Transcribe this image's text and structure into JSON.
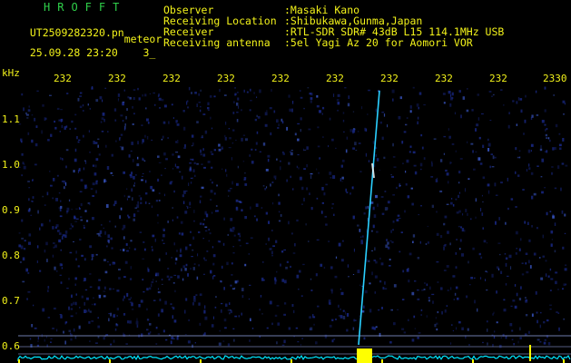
{
  "header": {
    "brand": "HROFFT",
    "filename": "UT2509282320.pn",
    "filename_suffix": "meteor",
    "timestamp": "25.09.28 23:20",
    "index": "3_"
  },
  "info": [
    {
      "label": "Observer",
      "value": ":Masaki Kano"
    },
    {
      "label": "Receiving Location",
      "value": ":Shibukawa,Gunma,Japan"
    },
    {
      "label": "Receiver",
      "value": ":RTL-SDR SDR# 43dB L15 114.1MHz USB"
    },
    {
      "label": "Receiving antenna",
      "value": ":5el Yagi Az 20 for Aomori VOR"
    }
  ],
  "y_axis": {
    "unit": "kHz",
    "ticks": [
      "1.1",
      "1.0",
      "0.9",
      "0.8",
      "0.7",
      "0.6"
    ]
  },
  "x_axis": {
    "ticks": [
      "232",
      "232",
      "232",
      "232",
      "232",
      "232",
      "232",
      "232",
      "232",
      "2330"
    ]
  },
  "colors": {
    "text": "#f2f21a",
    "brand": "#2fd04a",
    "background": "#000000",
    "noise": "#1a2a8a",
    "meteor": "#2ad0ff",
    "baseline": "#00e6ff",
    "burst": "#ffff00"
  }
}
